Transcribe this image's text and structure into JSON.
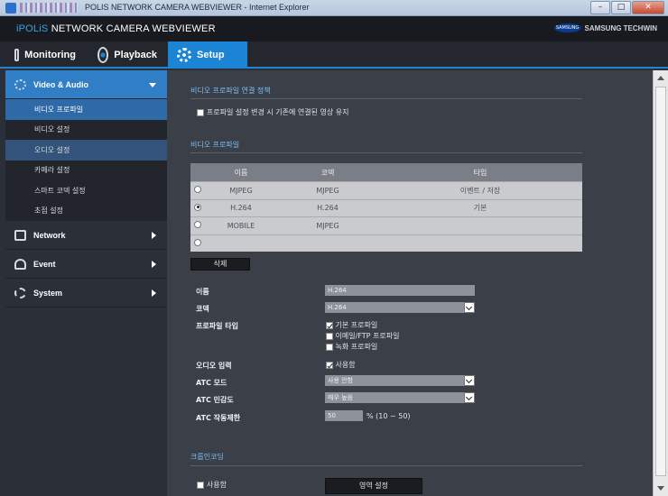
{
  "window": {
    "title": "POLIS NETWORK CAMERA WEBVIEWER - Internet Explorer",
    "min": "–",
    "max": "□",
    "close": "✕"
  },
  "header": {
    "brand_prefix": "iPOLiS",
    "brand_suffix": "NETWORK CAMERA WEBVIEWER",
    "company_logo": "SAMSUNG",
    "company": "SAMSUNG TECHWIN"
  },
  "tabs": [
    {
      "label": "Monitoring",
      "icon": "monitor-icon",
      "active": false
    },
    {
      "label": "Playback",
      "icon": "playback-icon",
      "active": false
    },
    {
      "label": "Setup",
      "icon": "gear-icon",
      "active": true
    }
  ],
  "sidebar": {
    "sections": [
      {
        "label": "Video & Audio",
        "icon": "film-icon",
        "expanded": true,
        "items": [
          "비디오 프로파일",
          "비디오 설정",
          "오디오 설정",
          "카메라 설정",
          "스마트 코덱 설정",
          "초점 설정"
        ]
      },
      {
        "label": "Network",
        "icon": "network-icon",
        "expanded": false
      },
      {
        "label": "Event",
        "icon": "event-icon",
        "expanded": false
      },
      {
        "label": "System",
        "icon": "system-icon",
        "expanded": false
      }
    ]
  },
  "main": {
    "link_section": {
      "title": "비디오 프로파일 연결 정책",
      "checkbox_label": "프로파일 설정 변경 시 기존에 연결된 영상 유지",
      "checked": false
    },
    "profile_section": {
      "title": "비디오 프로파일",
      "columns": [
        "이름",
        "코덱",
        "타입"
      ],
      "rows": [
        {
          "name": "MJPEG",
          "codec": "MJPEG",
          "type": "이벤트 / 저장",
          "selected": false
        },
        {
          "name": "H.264",
          "codec": "H.264",
          "type": "기본",
          "selected": true
        },
        {
          "name": "MOBILE",
          "codec": "MJPEG",
          "type": "",
          "selected": false
        },
        {
          "name": "",
          "codec": "",
          "type": "",
          "selected": false
        }
      ],
      "delete_label": "삭제"
    },
    "form": {
      "name_label": "이름",
      "name_value": "H.264",
      "codec_label": "코덱",
      "codec_value": "H.264",
      "profile_type_label": "프로파일 타입",
      "profile_types": [
        {
          "label": "기본 프로파일",
          "checked": true
        },
        {
          "label": "이메일/FTP 프로파일",
          "checked": false
        },
        {
          "label": "녹화 프로파일",
          "checked": false
        }
      ],
      "audio_label": "오디오 입력",
      "audio_option": "사용함",
      "audio_checked": true,
      "atc_mode_label": "ATC 모드",
      "atc_mode_value": "사용 안함",
      "atc_sens_label": "ATC 민감도",
      "atc_sens_value": "매우 높음",
      "atc_limit_label": "ATC 작동제한",
      "atc_limit_value": "50",
      "atc_limit_unit": "% (10 ~ 50)"
    },
    "crop_section": {
      "title": "크롭인코딩",
      "enable_label": "사용함",
      "enable_checked": false,
      "area_button": "영역 설정"
    }
  }
}
